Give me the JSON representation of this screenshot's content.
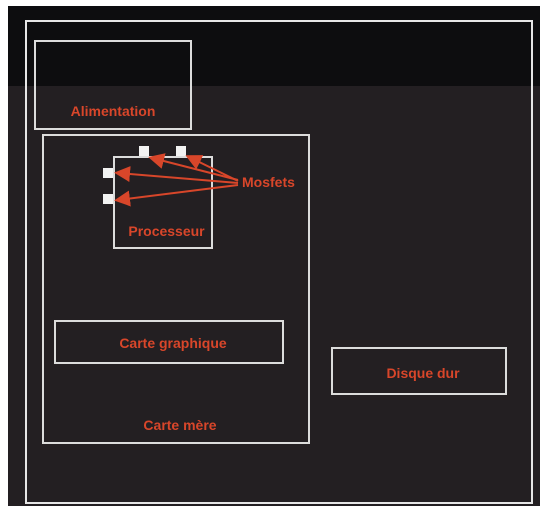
{
  "diagram": {
    "components": {
      "power_supply": "Alimentation",
      "motherboard": "Carte mère",
      "cpu": "Processeur",
      "mosfets": "Mosfets",
      "gpu": "Carte graphique",
      "hard_drive": "Disque dur"
    },
    "colors": {
      "label": "#d8462a",
      "arrow": "#d8462a",
      "border": "#dcdcdc",
      "background": "#231f22",
      "top_band": "#0d0d0f"
    }
  }
}
